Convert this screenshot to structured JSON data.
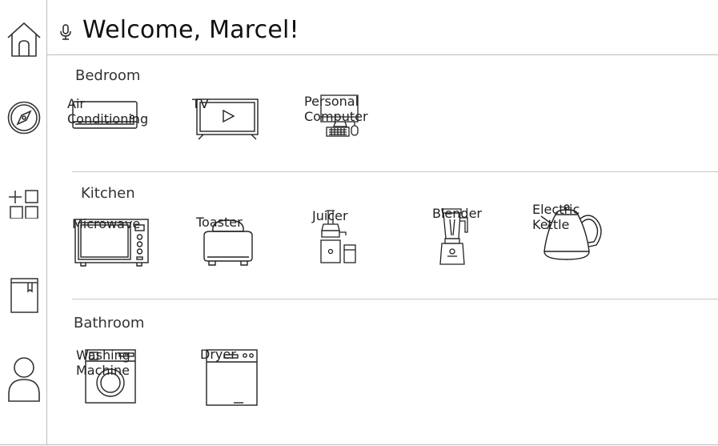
{
  "header": {
    "title": "Welcome, Marcel!"
  },
  "sidebar": {
    "items": [
      "home",
      "explore",
      "add-device",
      "notes",
      "profile"
    ]
  },
  "sections": [
    {
      "title": "Bedroom",
      "devices": [
        "Air Conditioning",
        "TV",
        "Personal Computer"
      ]
    },
    {
      "title": "Kitchen",
      "devices": [
        "Microwave",
        "Toaster",
        "Juicer",
        "Blender",
        "Electric Kettle"
      ]
    },
    {
      "title": "Bathroom",
      "devices": [
        "Washing Machine",
        "Dryer"
      ]
    }
  ]
}
